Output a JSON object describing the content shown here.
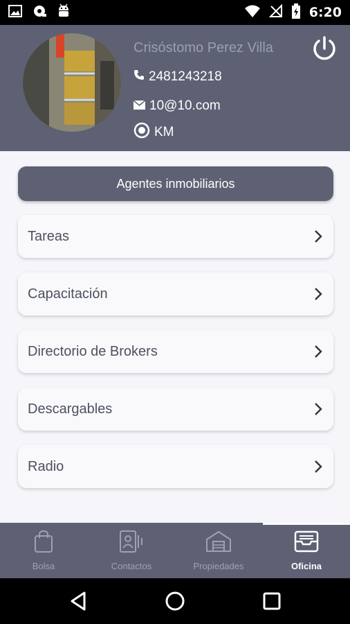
{
  "status_bar": {
    "time": "6:20",
    "left_icons": [
      "image-icon",
      "headset-icon",
      "android-icon"
    ],
    "right_icons": [
      "wifi-icon",
      "no-signal-icon",
      "battery-charging-icon"
    ]
  },
  "profile": {
    "name": "Crisóstomo Perez Villa",
    "phone": "2481243218",
    "email": "10@10.com",
    "unit": "KM"
  },
  "section_button": {
    "label": "Agentes inmobiliarios"
  },
  "menu": {
    "items": [
      {
        "label": "Tareas"
      },
      {
        "label": "Capacitación"
      },
      {
        "label": "Directorio de Brokers"
      },
      {
        "label": "Descargables"
      },
      {
        "label": "Radio"
      }
    ]
  },
  "tabs": [
    {
      "label": "Bolsa",
      "icon": "bag-icon"
    },
    {
      "label": "Contactos",
      "icon": "contacts-icon"
    },
    {
      "label": "Propiedades",
      "icon": "warehouse-icon"
    },
    {
      "label": "Oficina",
      "icon": "inbox-icon",
      "active": true
    }
  ],
  "colors": {
    "header_bg": "#5d6173",
    "page_bg": "#f5f5fa",
    "card_bg": "#f9f9fc",
    "text_dark": "#4d515e",
    "muted_name": "#9aa0ad"
  }
}
